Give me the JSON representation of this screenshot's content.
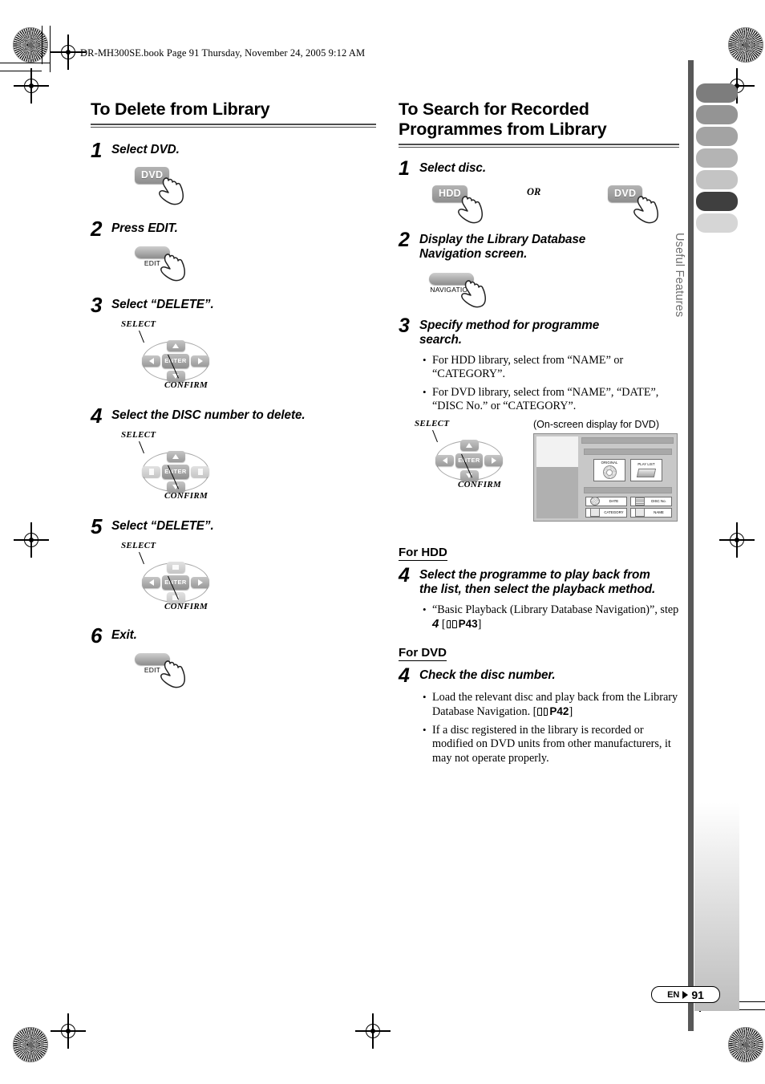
{
  "page": {
    "book_header": "DR-MH300SE.book  Page 91  Thursday, November 24, 2005  9:12 AM",
    "footer_locale": "EN",
    "footer_page": "91",
    "side_tab_label": "Useful Features"
  },
  "left_column": {
    "title": "To Delete from Library",
    "steps": [
      {
        "num": "1",
        "text": "Select DVD.",
        "art": "key-dvd",
        "key_label": "DVD"
      },
      {
        "num": "2",
        "text": "Press EDIT.",
        "art": "key-edit",
        "key_label": "EDIT"
      },
      {
        "num": "3",
        "text": "Select “DELETE”.",
        "art": "cluster",
        "select_label": "SELECT",
        "confirm_label": "CONFIRM",
        "enter_label": "ENTER"
      },
      {
        "num": "4",
        "text": "Select the DISC number to delete.",
        "art": "cluster",
        "select_label": "SELECT",
        "confirm_label": "CONFIRM",
        "enter_label": "ENTER"
      },
      {
        "num": "5",
        "text": "Select “DELETE”.",
        "art": "cluster",
        "select_label": "SELECT",
        "confirm_label": "CONFIRM",
        "enter_label": "ENTER"
      },
      {
        "num": "6",
        "text": "Exit.",
        "art": "key-edit",
        "key_label": "EDIT"
      }
    ]
  },
  "right_column": {
    "title": "To Search for Recorded Programmes from Library",
    "step1": {
      "num": "1",
      "text": "Select disc.",
      "key_hdd": "HDD",
      "or_label": "OR",
      "key_dvd": "DVD"
    },
    "step2": {
      "num": "2",
      "text": "Display the Library Database Navigation screen.",
      "key_navigation": "NAVIGATION"
    },
    "step3": {
      "num": "3",
      "text": "Specify method for programme search.",
      "bullets": [
        "For HDD library, select from “NAME” or “CATEGORY”.",
        "For DVD library, select from “NAME”, “DATE”, “DISC No.” or “CATEGORY”."
      ],
      "select_label": "SELECT",
      "confirm_label": "CONFIRM",
      "enter_label": "ENTER",
      "osd_caption": "(On-screen display for DVD)",
      "osd_tiles": [
        "ORIGINAL",
        "PLAY LIST"
      ],
      "osd_buttons": [
        "DATE",
        "DISC No.",
        "CATEGORY",
        "NAME"
      ]
    },
    "for_hdd": {
      "heading": "For HDD",
      "num": "4",
      "text": "Select the programme to play back from the list, then select the playback method.",
      "bullet_pre": "“Basic Playback (Library Database Navigation)”, step",
      "bullet_step": "4",
      "bullet_ref": "P43"
    },
    "for_dvd": {
      "heading": "For DVD",
      "num": "4",
      "text": "Check the disc number.",
      "bullet1_pre": "Load the relevant disc and play back from the Library Database Navigation. [",
      "bullet1_ref": "P42",
      "bullet1_post": "]",
      "bullet2": "If a disc registered in the library is recorded or modified on DVD units from other manufacturers, it may not operate properly."
    }
  },
  "colors": {
    "rule": "#4d4d4d",
    "spine": "#585858",
    "tab_active": "#3f3f3f",
    "side_text": "#6e6e6e"
  },
  "tab_shades": [
    "#7d7d7d",
    "#949494",
    "#a3a3a3",
    "#b4b4b4",
    "#c4c4c4",
    "#3f3f3f",
    "#d6d6d6"
  ]
}
